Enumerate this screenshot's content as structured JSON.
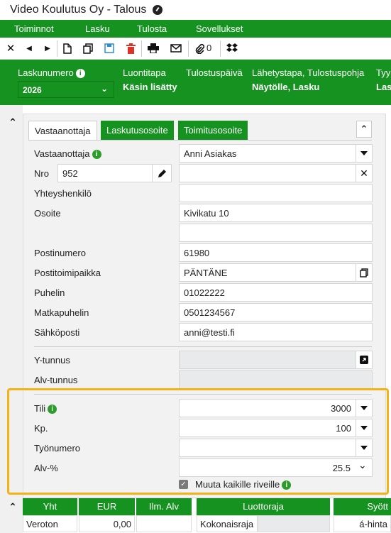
{
  "window": {
    "title": "Video Koulutus Oy - Talous"
  },
  "menu": [
    "Toiminnot",
    "Lasku",
    "Tulosta",
    "Sovellukset"
  ],
  "toolbar": {
    "attachment_count": "0",
    "icons": [
      "close-icon",
      "prev-icon",
      "next-icon",
      "new-document-icon",
      "copy-icon",
      "save-icon",
      "delete-icon",
      "print-icon",
      "email-icon",
      "attachment-icon",
      "dropbox-icon"
    ],
    "colors": {
      "delete": "#d9342b",
      "save": "#2a8bd6"
    }
  },
  "header": {
    "invoice_number_label": "Laskunumero",
    "invoice_number_value": "2026",
    "creation_method_label": "Luontitapa",
    "creation_method_value": "Käsin lisätty",
    "print_date_label": "Tulostuspäivä",
    "send_method_label": "Lähetystapa, Tulostuspohja",
    "send_method_value": "Näytölle, Lasku",
    "type_label": "Tyy",
    "type_value": "Las"
  },
  "tabs": [
    "Vastaanottaja",
    "Laskutusosoite",
    "Toimitusosoite"
  ],
  "form": {
    "recipient_label": "Vastaanottaja",
    "recipient_value": "Anni Asiakas",
    "nro_label": "Nro",
    "nro_value": "952",
    "contact_label": "Yhteyshenkilö",
    "address_label": "Osoite",
    "address_value": "Kivikatu 10",
    "postal_code_label": "Postinumero",
    "postal_code_value": "61980",
    "city_label": "Postitoimipaikka",
    "city_value": "PÄNTÄNE",
    "phone_label": "Puhelin",
    "phone_value": "01022222",
    "mobile_label": "Matkapuhelin",
    "mobile_value": "0501234567",
    "email_label": "Sähköposti",
    "email_value": "anni@testi.fi",
    "business_id_label": "Y-tunnus",
    "vat_id_label": "Alv-tunnus",
    "account_label": "Tili",
    "account_value": "3000",
    "cost_center_label": "Kp.",
    "cost_center_value": "100",
    "job_number_label": "Työnumero",
    "vat_percent_label": "Alv-%",
    "vat_percent_value": "25.5",
    "apply_all_rows_label": "Muuta kaikille riveille"
  },
  "bottom_table": {
    "headers": [
      "Yht",
      "EUR",
      "Ilm. Alv",
      "Luottoraja",
      "Syött"
    ],
    "row": {
      "label": "Veroton",
      "eur": "0,00",
      "credit_label": "Kokonaisraja",
      "input_label": "á-hinta"
    }
  },
  "colors": {
    "brand_green": "#15921f",
    "highlight": "#f5b116"
  }
}
